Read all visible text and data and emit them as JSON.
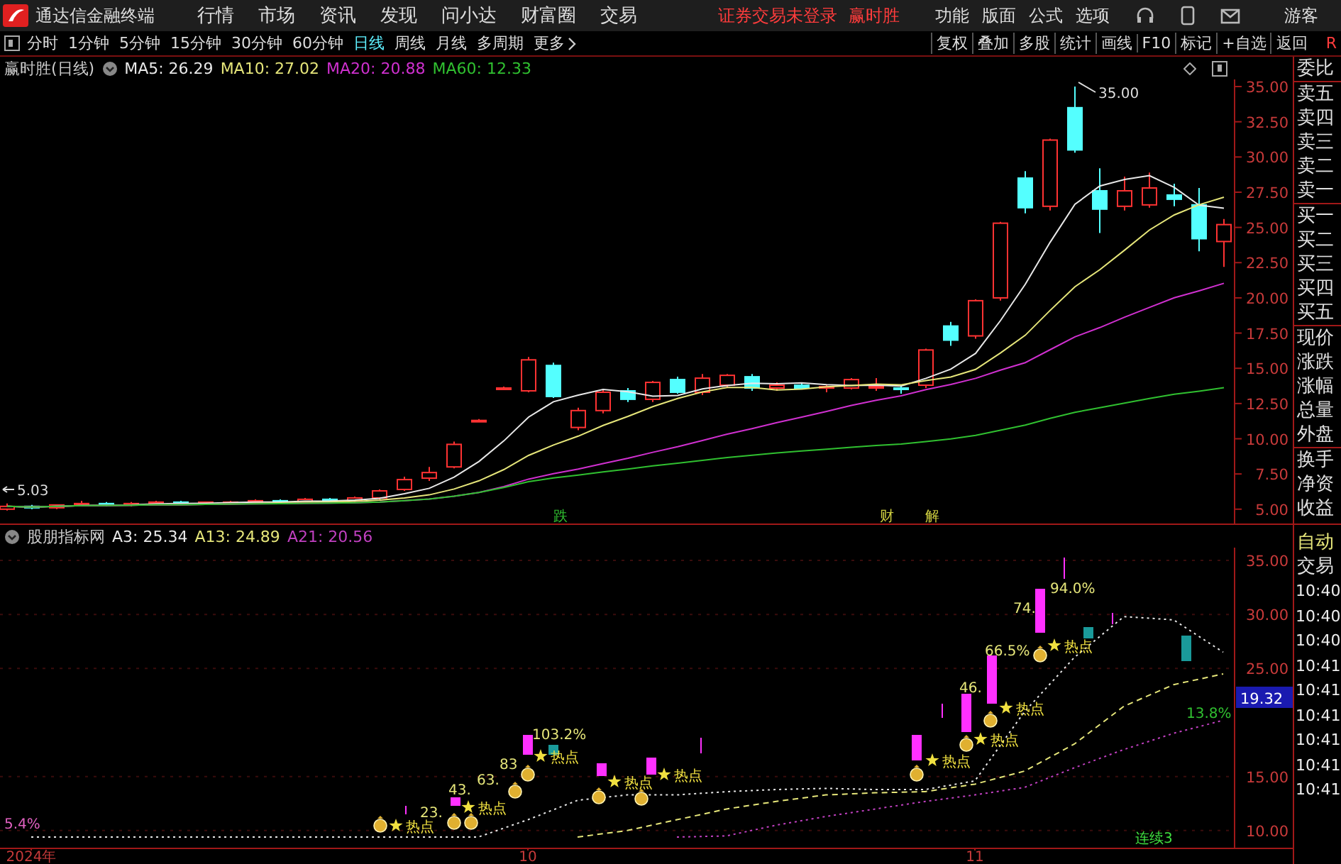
{
  "title_bar": {
    "app_name": "通达信金融终端",
    "menus": [
      "行情",
      "市场",
      "资讯",
      "发现",
      "问小达",
      "财富圈",
      "交易"
    ],
    "login_notice": "证券交易未登录",
    "stock_name": "赢时胜",
    "right_menus": [
      "功能",
      "版面",
      "公式",
      "选项"
    ],
    "user": "游客"
  },
  "toolbar": {
    "periods": [
      {
        "label": "分时",
        "selected": false
      },
      {
        "label": "1分钟",
        "selected": false
      },
      {
        "label": "5分钟",
        "selected": false
      },
      {
        "label": "15分钟",
        "selected": false
      },
      {
        "label": "30分钟",
        "selected": false
      },
      {
        "label": "60分钟",
        "selected": false
      },
      {
        "label": "日线",
        "selected": true
      },
      {
        "label": "周线",
        "selected": false
      },
      {
        "label": "月线",
        "selected": false
      },
      {
        "label": "多周期",
        "selected": false
      },
      {
        "label": "更多",
        "selected": false
      }
    ],
    "tools": [
      "复权",
      "叠加",
      "多股",
      "统计",
      "画线",
      "F10",
      "标记",
      "+自选",
      "返回"
    ],
    "corner_mark": "R"
  },
  "main_chart": {
    "title": "赢时胜(日线)",
    "indicators": [
      {
        "label": "MA5: 26.29",
        "color": "#e8e8e8"
      },
      {
        "label": "MA10: 27.02",
        "color": "#e6e67a"
      },
      {
        "label": "MA20: 20.88",
        "color": "#d030d0"
      },
      {
        "label": "MA60: 12.33",
        "color": "#30c030"
      }
    ],
    "y_ticks": [
      "35.00",
      "32.50",
      "30.00",
      "27.50",
      "25.00",
      "22.50",
      "20.00",
      "17.50",
      "15.00",
      "12.50",
      "10.00",
      "7.50",
      "5.00"
    ],
    "peak_label": "35.00",
    "low_label": "5.03",
    "event_marks": [
      {
        "label": "跌",
        "color": "#30c030"
      },
      {
        "label": "财",
        "color": "#d0d040"
      },
      {
        "label": "解",
        "color": "#d0d040"
      }
    ]
  },
  "sub_chart": {
    "title": "股朋指标网",
    "readings": [
      ": 25.34",
      ": 24.89",
      ": 20.56"
    ],
    "chart_data": {
      "type": "line",
      "grid": true,
      "categories": [
        "2024年",
        null,
        null,
        null,
        null,
        null,
        null,
        null,
        null,
        null,
        "10",
        null,
        null,
        null,
        null,
        null,
        null,
        null,
        null,
        "11",
        null,
        null,
        null,
        null,
        null
      ],
      "ylim": [
        8.35,
        36.18
      ],
      "yticks": [
        {
          "value": 35,
          "label": "35.00"
        },
        {
          "value": 30,
          "label": "30.00"
        },
        {
          "value": 25,
          "label": "25.00"
        },
        {
          "value": 15,
          "label": "15.00"
        },
        {
          "value": 10,
          "label": "10.00"
        }
      ],
      "series": [
        {
          "name": "A3",
          "color": "#e8e8e8",
          "line_style": "dotted",
          "values": [
            9.4,
            9.4,
            9.4,
            9.4,
            9.4,
            9.4,
            9.4,
            9.4,
            9.4,
            9.4,
            11,
            12.8,
            13.3,
            13.3,
            13.6,
            13.8,
            13.9,
            13.8,
            13.8,
            14.6,
            21,
            26,
            29.8,
            29.5,
            26.5
          ]
        },
        {
          "name": "A13",
          "color": "#e6e67a",
          "line_style": "dashed",
          "values": [
            null,
            null,
            null,
            null,
            null,
            null,
            null,
            null,
            null,
            null,
            null,
            9.4,
            10,
            11,
            12,
            12.7,
            13.3,
            13.5,
            13.6,
            14.3,
            15.5,
            18,
            21.5,
            23.5,
            24.5
          ]
        },
        {
          "name": "A21",
          "color": "#c040c0",
          "line_style": "dotted",
          "values": [
            null,
            null,
            null,
            null,
            null,
            null,
            null,
            null,
            null,
            null,
            null,
            null,
            null,
            9.4,
            9.5,
            10.5,
            11.3,
            12,
            12.7,
            13.3,
            14,
            15.8,
            17.5,
            19,
            20.2
          ]
        }
      ]
    },
    "current_value": "19.32",
    "start_label": "5.4%",
    "gain_labels": [
      {
        "label": "23.",
        "color": "#e6e67a"
      },
      {
        "label": "43.",
        "color": "#e6e67a"
      },
      {
        "label": "63.",
        "color": "#e6e67a"
      },
      {
        "label": "83",
        "color": "#e6e67a"
      },
      {
        "label": "103.2%",
        "color": "#e6e67a"
      },
      {
        "label": "46.",
        "color": "#e6e67a"
      },
      {
        "label": "66.5%",
        "color": "#e6e67a"
      },
      {
        "label": "74.",
        "color": "#e6e67a"
      },
      {
        "label": "94.0%",
        "color": "#e6e67a"
      },
      {
        "label": "13.8%",
        "color": "#30c030"
      }
    ],
    "hot_points": [
      "热点",
      "热点",
      "热点",
      "热点",
      "热点",
      "热点",
      "热点",
      "热点",
      "热点"
    ],
    "streak_label": "连续3"
  },
  "quote_panel": {
    "fields": [
      "委比",
      "卖五",
      "卖四",
      "卖三",
      "卖二",
      "卖一",
      "买一",
      "买二",
      "买三",
      "买四",
      "买五",
      "现价",
      "涨跌",
      "涨幅",
      "总量",
      "外盘",
      "换手",
      "净资",
      "收益"
    ],
    "mode_label": "自动",
    "trade_label": "交易",
    "trade_times": [
      "10:40",
      "10:40",
      "10:40",
      "10:41",
      "10:41",
      "10:41",
      "10:41",
      "10:41",
      "10:41"
    ]
  }
}
